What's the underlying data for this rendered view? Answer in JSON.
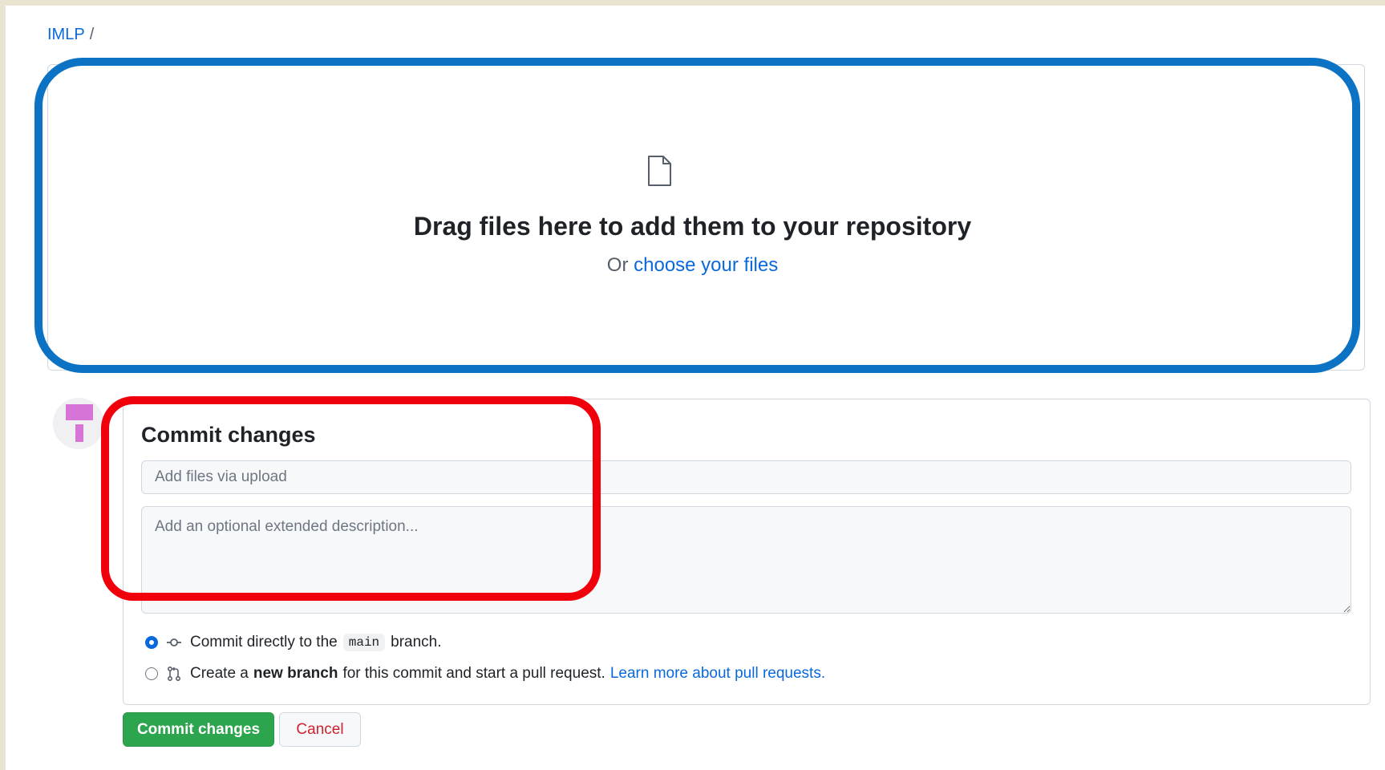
{
  "breadcrumb": {
    "repo": "IMLP",
    "separator": "/"
  },
  "dropzone": {
    "title": "Drag files here to add them to your repository",
    "or_text": "Or",
    "choose_link": "choose your files",
    "icon": "file-icon"
  },
  "commit": {
    "title": "Commit changes",
    "summary_placeholder": "Add files via upload",
    "description_placeholder": "Add an optional extended description...",
    "option_direct": {
      "prefix": "Commit directly to the",
      "branch": "main",
      "suffix": "branch.",
      "selected": true
    },
    "option_new": {
      "prefix": "Create a",
      "bold": "new branch",
      "suffix": "for this commit and start a pull request.",
      "link": "Learn more about pull requests.",
      "selected": false
    },
    "commit_button": "Commit changes",
    "cancel_button": "Cancel"
  },
  "colors": {
    "accent": "#0969da",
    "commit_green": "#2da44e",
    "cancel_red": "#cf222e",
    "highlight_blue": "#0b72c4",
    "highlight_red": "#f0000a",
    "avatar_pink": "#d774d7"
  }
}
